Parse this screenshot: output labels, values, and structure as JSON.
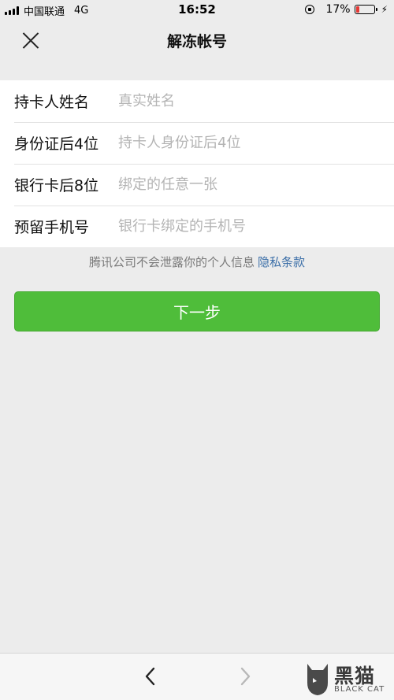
{
  "status_bar": {
    "carrier": "中国联通",
    "network": "4G",
    "time": "16:52",
    "battery_percent": "17%",
    "battery_level": 0.17,
    "battery_color": "#e53935"
  },
  "nav": {
    "title": "解冻帐号",
    "close_icon": "close-icon"
  },
  "form": {
    "fields": [
      {
        "label": "持卡人姓名",
        "placeholder": "真实姓名",
        "value": ""
      },
      {
        "label": "身份证后4位",
        "placeholder": "持卡人身份证后4位",
        "value": ""
      },
      {
        "label": "银行卡后8位",
        "placeholder": "绑定的任意一张",
        "value": ""
      },
      {
        "label": "预留手机号",
        "placeholder": "银行卡绑定的手机号",
        "value": ""
      }
    ]
  },
  "privacy": {
    "text": "腾讯公司不会泄露你的个人信息",
    "link": "隐私条款"
  },
  "next_button": {
    "label": "下一步",
    "color": "#4fbd3a"
  },
  "toolbar": {
    "back_icon": "chevron-left-icon",
    "forward_icon": "chevron-right-icon"
  },
  "watermark": {
    "text": "黑猫",
    "sub": "BLACK CAT"
  }
}
